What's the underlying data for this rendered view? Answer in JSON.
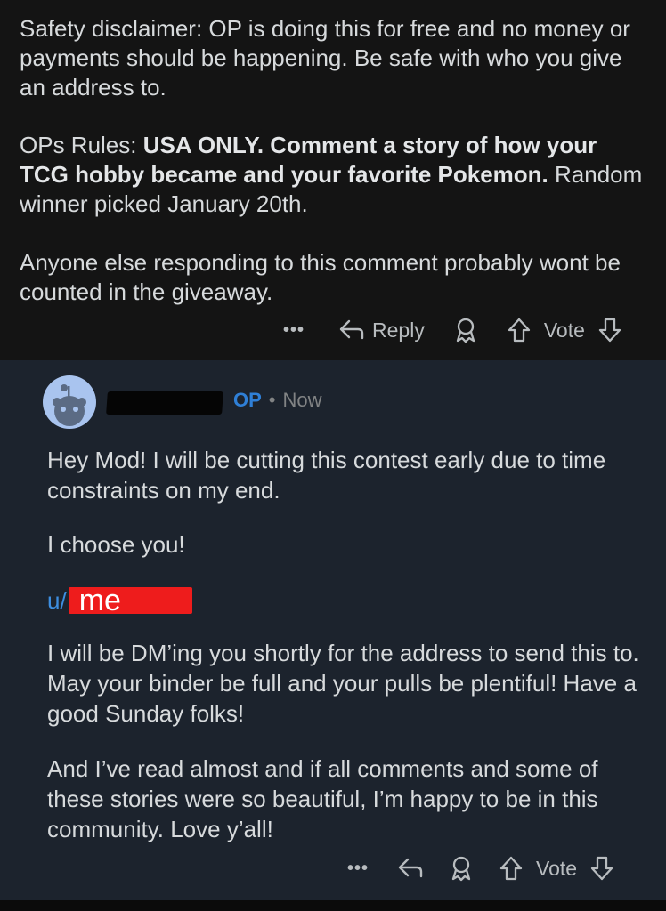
{
  "parent_comment": {
    "paragraph1": "Safety disclaimer: OP is doing this for free and no money or payments should be happening. Be safe with who you give an address to.",
    "paragraph2_prefix": "OPs Rules: ",
    "paragraph2_bold": "USA ONLY. Comment a story of how your TCG hobby became and your favorite Pokemon.",
    "paragraph2_suffix": " Random winner picked January 20th.",
    "paragraph3": "Anyone else responding to this comment probably wont be counted in the giveaway.",
    "actions": {
      "more": "•••",
      "reply_label": "Reply",
      "vote_label": "Vote"
    }
  },
  "reply_comment": {
    "op_badge": "OP",
    "separator": "•",
    "timestamp": "Now",
    "paragraph1": "Hey Mod! I will be cutting this contest early due to time constraints on my end.",
    "paragraph2": "I choose you!",
    "mention_prefix": "u/",
    "mention_overlay": "me",
    "paragraph4": "I will be DM’ing you shortly for the address to send this to. May your binder be full and your pulls be plentiful! Have a good Sunday folks!",
    "paragraph5": "And I’ve read almost and if all comments and some of these stories were so beautiful, I’m happy to be in this community. Love y’all!",
    "actions": {
      "more": "•••",
      "vote_label": "Vote"
    }
  },
  "colors": {
    "op_blue": "#2f7fd6",
    "reply_background": "#1c232d",
    "parent_background": "#141414",
    "redaction_red": "#ee1c1c"
  },
  "icons": [
    "reply-arrow-icon",
    "award-icon",
    "upvote-icon",
    "downvote-icon",
    "more-options-icon",
    "snoo-avatar-icon"
  ]
}
